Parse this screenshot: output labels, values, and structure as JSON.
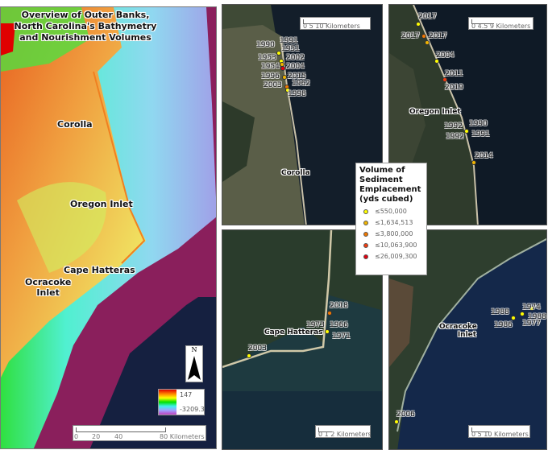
{
  "overview": {
    "title_lines": [
      "Overview of Outer Banks,",
      "North Carolina's Bathymetry",
      "and Nourishment Volumes"
    ],
    "places": [
      "Corolla",
      "Oregon Inlet",
      "Cape Hatteras",
      "Ocracoke",
      "Inlet"
    ],
    "north_arrow_label": "N",
    "elevation_legend": {
      "max": "147",
      "min": "-3209.3",
      "ramp": [
        "#e00000",
        "#ff8000",
        "#ffff00",
        "#00e000",
        "#40f0f0",
        "#a0a0ff",
        "#c040c0"
      ]
    },
    "scale": {
      "ticks": [
        "0",
        "20",
        "40",
        "80 Kilometers"
      ]
    }
  },
  "insets": {
    "corolla": {
      "place": "Corolla",
      "scale": "0   5   10 Kilometers",
      "labels": [
        "1990",
        "1991",
        "1951",
        "1953",
        "2002",
        "1954",
        "2004",
        "1996",
        "2015",
        "1962",
        "2003",
        "1998"
      ]
    },
    "oregon": {
      "place": "Oregon Inlet",
      "scale": "0  4.5  9 Kilometers",
      "labels": [
        "2017",
        "2017",
        "2017",
        "2004",
        "2011",
        "2019",
        "1992",
        "1990",
        "1992",
        "1991",
        "2014"
      ]
    },
    "hatteras": {
      "place": "Cape Hatteras",
      "scale": "0 1 2 Kilometers",
      "labels": [
        "2018",
        "1973",
        "1966",
        "1971",
        "2003"
      ]
    },
    "ocracoke": {
      "place_lines": [
        "Ocracoke",
        "Inlet"
      ],
      "scale": "0  5 10 Kilometers",
      "labels": [
        "1974",
        "1988",
        "1988",
        "1986",
        "1977",
        "2006"
      ]
    }
  },
  "legend": {
    "title": "Volume of Sediment Emplacement (yds cubed)",
    "classes": [
      {
        "label": "≤550,000",
        "color": "#ffff00"
      },
      {
        "label": "≤1,634,513",
        "color": "#f0b400"
      },
      {
        "label": "≤3,800,000",
        "color": "#f07800"
      },
      {
        "label": "≤10,063,900",
        "color": "#f03c10"
      },
      {
        "label": "≤26,009,300",
        "color": "#e00010"
      }
    ]
  }
}
